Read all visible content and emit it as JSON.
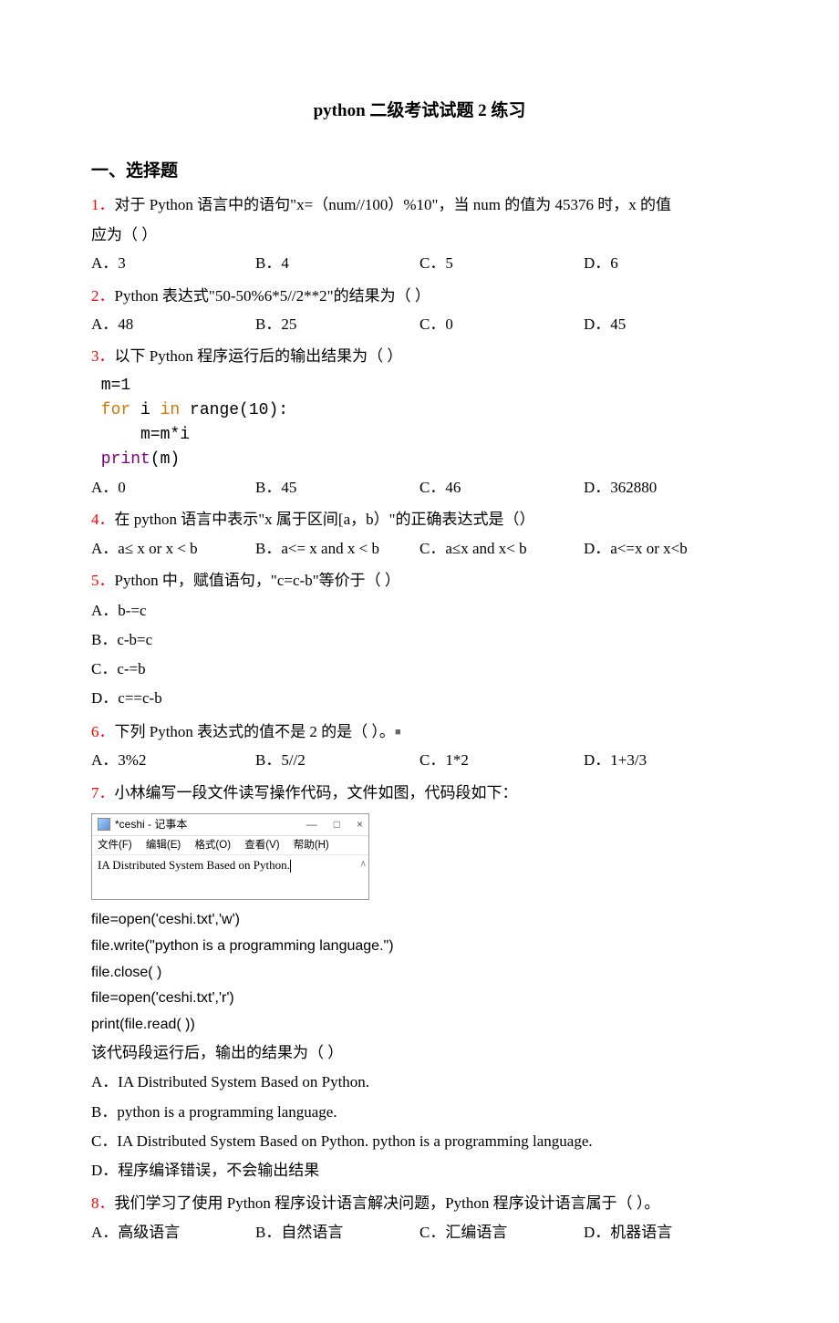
{
  "title": "python 二级考试试题 2 练习",
  "section1": {
    "header": "一、选择题",
    "q1": {
      "num": "1．",
      "text_a": "对于 Python 语言中的语句\"x=（num//100）%10\"，当 num 的值为 45376 时，x 的值",
      "text_b": "应为（  ）",
      "optA": "A．3",
      "optB": "B．4",
      "optC": "C．5",
      "optD": "D．6"
    },
    "q2": {
      "num": "2．",
      "text": "Python 表达式\"50-50%6*5//2**2\"的结果为（  ）",
      "optA": "A．48",
      "optB": "B．25",
      "optC": "C．0",
      "optD": "D．45"
    },
    "q3": {
      "num": "3．",
      "text": "以下 Python 程序运行后的输出结果为（  ）",
      "code1": " m=1",
      "code2_a": " for",
      "code2_b": " i ",
      "code2_c": "in",
      "code2_d": " range(10):",
      "code3": "     m=m*i",
      "code4a": " print",
      "code4b": "(m)",
      "optA": "A．0",
      "optB": "B．45",
      "optC": "C．46",
      "optD": "D．362880"
    },
    "q4": {
      "num": "4．",
      "text": "在 python 语言中表示\"x 属于区间[a，b）\"的正确表达式是（）",
      "optA": "A．a≤ x or x < b",
      "optB": "B．a<= x and x < b",
      "optC": "C．a≤x and x< b",
      "optD": "D．a<=x or x<b"
    },
    "q5": {
      "num": "5．",
      "text": "Python 中，赋值语句，\"c=c-b\"等价于（  ）",
      "optA": "A．b-=c",
      "optB": "B．c-b=c",
      "optC": "C．c-=b",
      "optD": "D．c==c-b"
    },
    "q6": {
      "num": "6．",
      "text_a": "下列 Python 表达式的值不是 2 的是（   ）。",
      "sq": "■",
      "optA": "A．3%2",
      "optB": "B．5//2",
      "optC": "C．1*2",
      "optD": "D．1+3/3"
    },
    "q7": {
      "num": "7．",
      "text": "小林编写一段文件读写操作代码，文件如图，代码段如下：",
      "notepad": {
        "title": "*ceshi - 记事本",
        "min": "—",
        "max": "□",
        "close": "×",
        "menu_file": "文件(F)",
        "menu_edit": "编辑(E)",
        "menu_format": "格式(O)",
        "menu_view": "查看(V)",
        "menu_help": "帮助(H)",
        "content": "IA Distributed System Based on Python.",
        "scroll": "∧"
      },
      "code1": "file=open('ceshi.txt','w')",
      "code2": "file.write(\"python is a programming language.\")",
      "code3": "file.close( )",
      "code4": "file=open('ceshi.txt','r')",
      "code5": "print(file.read( ))",
      "text2": "该代码段运行后，输出的结果为（  ）",
      "optA": "A．IA Distributed System Based on Python.",
      "optB": "B．python is a programming language.",
      "optC": "C．IA Distributed System Based on Python. python is a programming language.",
      "optD": "D．程序编译错误，不会输出结果"
    },
    "q8": {
      "num": "8．",
      "text": "我们学习了使用 Python 程序设计语言解决问题，Python 程序设计语言属于（   ）。",
      "optA": "A．高级语言",
      "optB": "B．自然语言",
      "optC": "C．汇编语言",
      "optD": "D．机器语言"
    }
  }
}
